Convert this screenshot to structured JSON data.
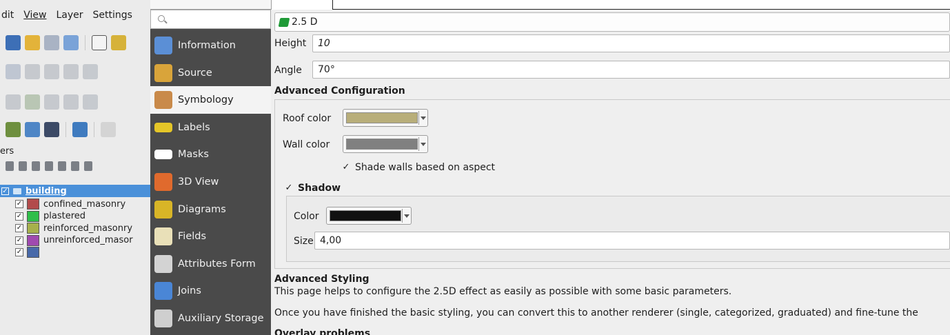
{
  "menubar": {
    "items": [
      "dit",
      "View",
      "Layer",
      "Settings"
    ]
  },
  "layers_panel": {
    "title": "ers",
    "root_layer": "building",
    "items": [
      {
        "label": "confined_masonry",
        "color": "#b24b4b",
        "checked": true
      },
      {
        "label": "plastered",
        "color": "#2fbe4a",
        "checked": true
      },
      {
        "label": "reinforced_masonry",
        "color": "#a6b04c",
        "checked": true
      },
      {
        "label": "unreinforced_masor",
        "color": "#a04ab0",
        "checked": true
      },
      {
        "label": "",
        "color": "#4869a9",
        "checked": true
      }
    ]
  },
  "sidebar": {
    "search_placeholder": "",
    "items": [
      {
        "label": "Information",
        "icon": "information-icon",
        "color": "#5b8fd6",
        "active": false
      },
      {
        "label": "Source",
        "icon": "source-icon",
        "color": "#d9a43a",
        "active": false
      },
      {
        "label": "Symbology",
        "icon": "symbology-icon",
        "color": "#c98a4a",
        "active": true
      },
      {
        "label": "Labels",
        "icon": "labels-icon",
        "color": "#e5c628",
        "active": false
      },
      {
        "label": "Masks",
        "icon": "masks-icon",
        "color": "#ffffff",
        "active": false
      },
      {
        "label": "3D View",
        "icon": "3d-view-icon",
        "color": "#e06a2d",
        "active": false
      },
      {
        "label": "Diagrams",
        "icon": "diagrams-icon",
        "color": "#d8b527",
        "active": false
      },
      {
        "label": "Fields",
        "icon": "fields-icon",
        "color": "#e9e0b8",
        "active": false
      },
      {
        "label": "Attributes Form",
        "icon": "attributes-form-icon",
        "color": "#d3d3d3",
        "active": false
      },
      {
        "label": "Joins",
        "icon": "joins-icon",
        "color": "#4a86d6",
        "active": false
      },
      {
        "label": "Auxiliary Storage",
        "icon": "auxiliary-storage-icon",
        "color": "#cfcfcf",
        "active": false
      }
    ]
  },
  "main": {
    "renderer": "2.5 D",
    "height_label": "Height",
    "height_value": "10",
    "angle_label": "Angle",
    "angle_value": "70°",
    "advanced_config_title": "Advanced Configuration",
    "roof_color_label": "Roof color",
    "roof_color": "#b8ae7a",
    "wall_color_label": "Wall color",
    "wall_color": "#808080",
    "shade_walls_label": "Shade walls based on aspect",
    "shadow_label": "Shadow",
    "shadow_color_label": "Color",
    "shadow_color": "#111111",
    "size_label": "Size",
    "size_value": "4,00",
    "advanced_styling_title": "Advanced Styling",
    "advanced_styling_text1": "This page helps to configure the 2.5D effect as easily as possible with some basic parameters.",
    "advanced_styling_text2": "Once you have finished the basic styling, you can convert this to another renderer (single, categorized, graduated) and fine-tune the",
    "cut_heading": "Overlay problems"
  }
}
